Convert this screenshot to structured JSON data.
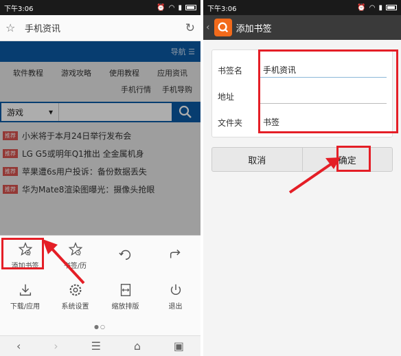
{
  "left": {
    "status": {
      "time": "下午3:06"
    },
    "addressbar": {
      "title": "手机资讯"
    },
    "page": {
      "nav_label": "导航 ☰",
      "categories": [
        "软件教程",
        "游戏攻略",
        "使用教程",
        "应用资讯"
      ],
      "categories_row2": [
        "手机行情",
        "手机导购"
      ],
      "search": {
        "selected": "游戏",
        "caret": "▾"
      },
      "news": [
        {
          "tag": "推荐",
          "text": "小米将于本月24日举行发布会"
        },
        {
          "tag": "推荐",
          "text": "LG G5或明年Q1推出 全金属机身"
        },
        {
          "tag": "推荐",
          "text": "苹果遭6s用户投诉：备份数据丢失"
        },
        {
          "tag": "推荐",
          "text": "华为Mate8渲染图曝光：摄像头抢眼"
        }
      ]
    },
    "menu": {
      "items": [
        {
          "label": "添加书签",
          "icon": "star-add-icon"
        },
        {
          "label": "书签/历",
          "icon": "bookmark-history-icon"
        },
        {
          "label": "",
          "icon": "refresh-icon"
        },
        {
          "label": "",
          "icon": "share-icon"
        },
        {
          "label": "下载/应用",
          "icon": "download-icon"
        },
        {
          "label": "系统设置",
          "icon": "gear-icon"
        },
        {
          "label": "缩放排版",
          "icon": "zoom-layout-icon"
        },
        {
          "label": "退出",
          "icon": "power-icon"
        }
      ],
      "pager": "●○"
    }
  },
  "right": {
    "status": {
      "time": "下午3:06"
    },
    "topbar": {
      "title": "添加书签"
    },
    "form": {
      "name_label": "书签名",
      "name_value": "手机资讯",
      "address_label": "地址",
      "address_value": "",
      "folder_label": "文件夹",
      "folder_value": "书签"
    },
    "buttons": {
      "cancel": "取消",
      "confirm": "确定"
    }
  },
  "colors": {
    "highlight": "#e41e26",
    "brand_blue": "#0b5aa6",
    "app_orange": "#f26a1b"
  }
}
